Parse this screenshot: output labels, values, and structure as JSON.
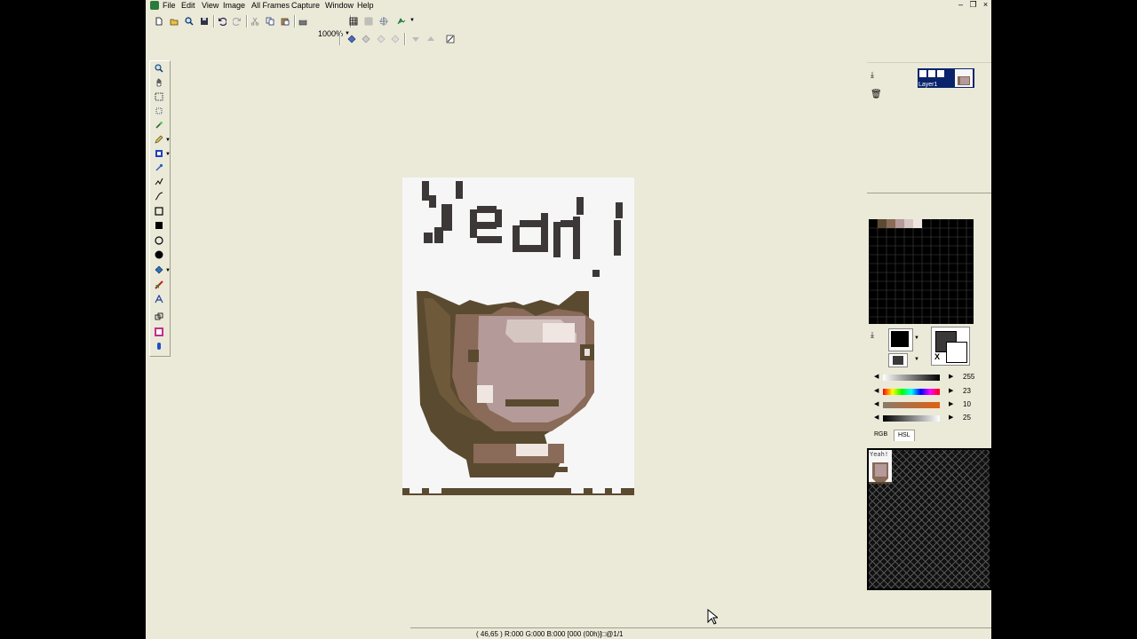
{
  "menubar": {
    "items": [
      "File",
      "Edit",
      "View",
      "Image",
      "All Frames",
      "Capture",
      "Window",
      "Help"
    ]
  },
  "toolbar": {
    "zoom_label": "1000%"
  },
  "icons": {
    "new": "new-file-icon",
    "open": "open-folder-icon",
    "find": "magnifier-icon",
    "save": "save-icon",
    "undo": "undo-icon",
    "redo": "redo-icon",
    "cut": "cut-icon",
    "copy": "copy-icon",
    "paste": "paste-icon",
    "scan": "scanner-icon",
    "grid": "grid-icon",
    "grid2": "fine-grid-icon",
    "fit": "fit-icon",
    "animate": "animation-icon"
  },
  "canvas": {
    "text": "Yeah!"
  },
  "layers": {
    "layer_name": "Layer1"
  },
  "palette": {
    "sliders": [
      {
        "value": "255",
        "gradient": "linear-gradient(to right,#fff,#000)"
      },
      {
        "value": "23",
        "gradient": "linear-gradient(to right,#f00,#ff0,#0f0,#0ff,#00f,#f0f,#f00)"
      },
      {
        "value": "10",
        "gradient": "linear-gradient(to right,#8a7a6a,#e06010)"
      },
      {
        "value": "25",
        "gradient": "linear-gradient(to right,#000,#fff)"
      }
    ],
    "tabs": [
      "RGB",
      "HSL"
    ],
    "primary_color": "#000000",
    "secondary_color": "#3a3838"
  },
  "frames": {
    "thumb_text": "Yeah!"
  },
  "status": {
    "text": "( 46,65 ) R:000 G:000 B:000  [000 (00h)]□@1/1"
  }
}
